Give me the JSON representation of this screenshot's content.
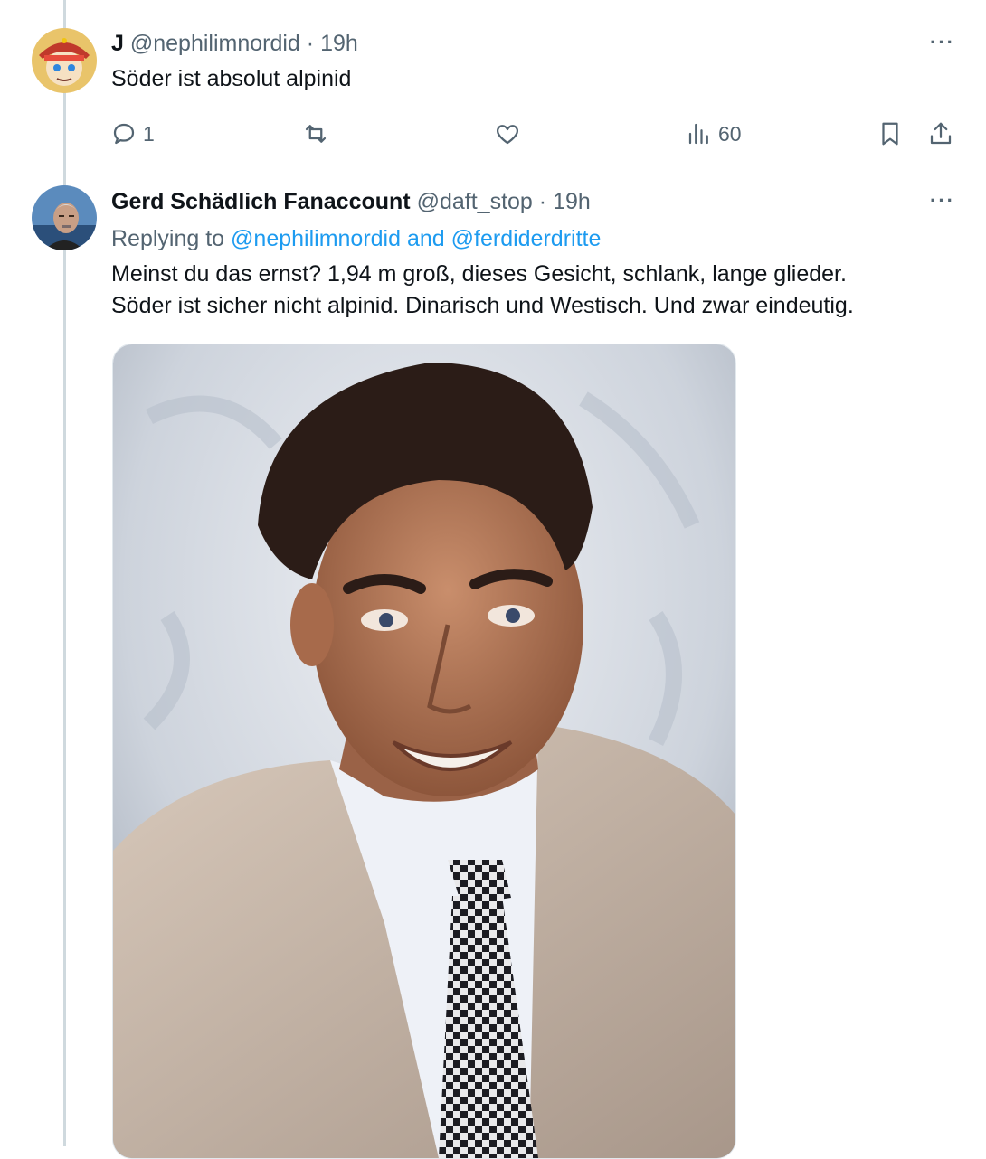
{
  "tweets": [
    {
      "display_name": "J",
      "handle": "@nephilimnordid",
      "separator": "·",
      "time": "19h",
      "text": "Söder ist absolut alpinid",
      "more": "···",
      "actions": {
        "reply_count": "1",
        "retweet_count": "",
        "like_count": "",
        "views_count": "60"
      }
    },
    {
      "display_name": "Gerd Schädlich Fanaccount",
      "handle": "@daft_stop",
      "separator": "·",
      "time": "19h",
      "replying_prefix": "Replying to",
      "replying_user1": "@nephilimnordid",
      "replying_and": "and",
      "replying_user2": "@ferdiderdritte",
      "text_line1": "Meinst du das ernst? 1,94 m groß, dieses Gesicht, schlank, lange glieder.",
      "text_line2": "Söder ist sicher nicht alpinid. Dinarisch und Westisch. Und zwar eindeutig.",
      "more": "···"
    }
  ],
  "colors": {
    "accent": "#1d9bf0",
    "muted": "#536471",
    "text": "#0f1419",
    "thread_line": "#cfd9de"
  }
}
